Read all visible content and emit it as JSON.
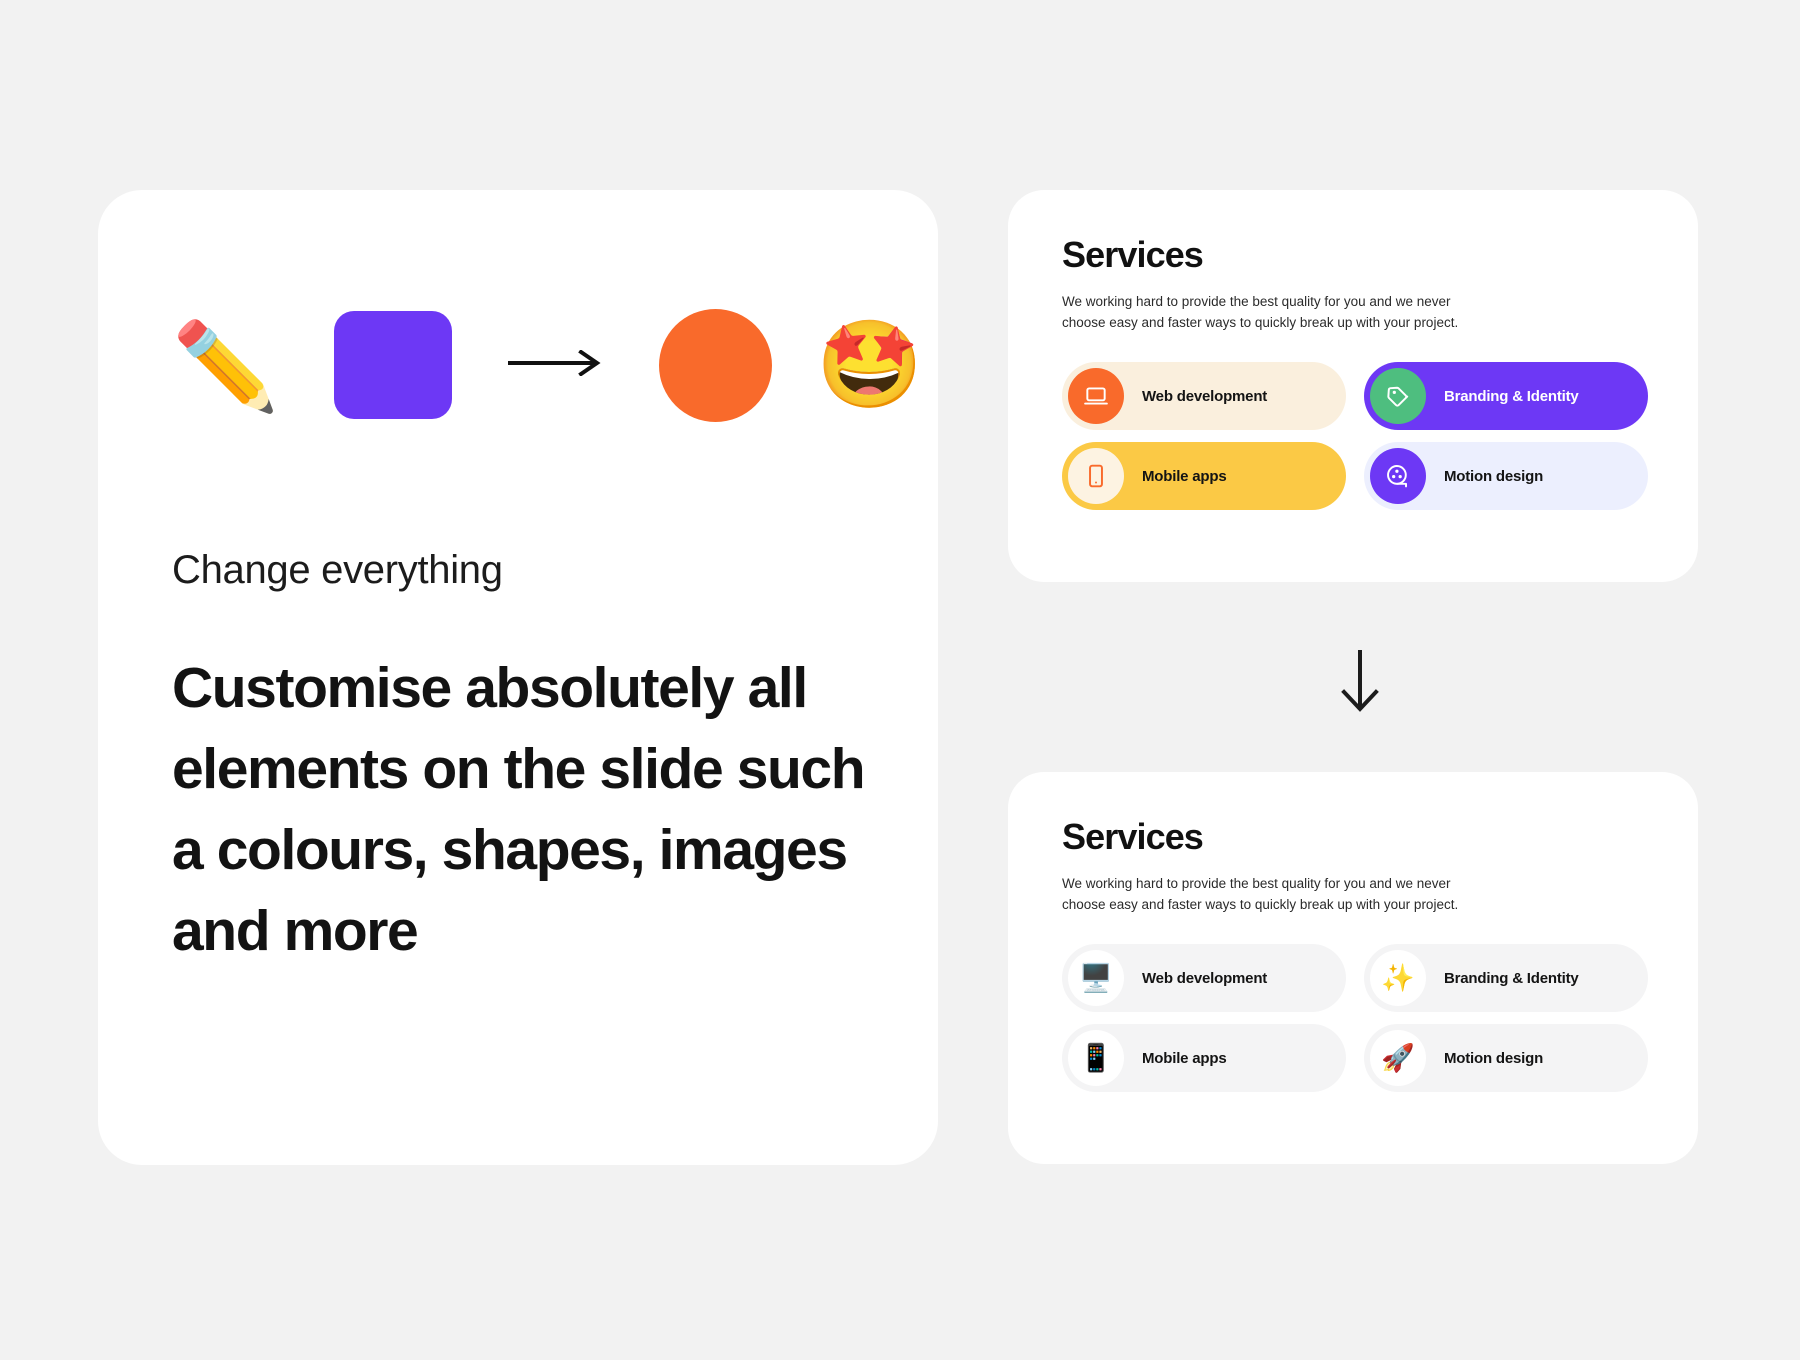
{
  "page": {
    "background_color": "#f2f2f2"
  },
  "left_panel": {
    "shapes": [
      {
        "name": "pencil-emoji",
        "glyph": "✏️"
      },
      {
        "name": "purple-rounded-square",
        "color": "#6d38f5"
      },
      {
        "name": "arrow-right-icon",
        "glyph": "→"
      },
      {
        "name": "orange-circle",
        "color": "#f96a2b"
      },
      {
        "name": "star-struck-emoji",
        "glyph": "🤩"
      }
    ],
    "eyebrow": "Change everything",
    "headline": "Customise absolutely all elements on the slide such a colours, shapes, images and more"
  },
  "divider": {
    "arrow_down_label": "↓"
  },
  "services_top": {
    "title": "Services",
    "description": "We working hard to provide the best quality for you and we never choose easy and faster ways to quickly break up with your project.",
    "items": [
      {
        "label": "Web development",
        "icon": "laptop-icon",
        "pill_color": "#faefdd",
        "icon_bg": "#f96a2b",
        "icon_color": "#ffffff"
      },
      {
        "label": "Branding & Identity",
        "icon": "tag-icon",
        "pill_color": "#6d38f5",
        "icon_bg": "#4ebe7f",
        "icon_color": "#ffffff"
      },
      {
        "label": "Mobile apps",
        "icon": "smartphone-icon",
        "pill_color": "#fbc945",
        "icon_bg": "#fdf3e2",
        "icon_color": "#f96a2b"
      },
      {
        "label": "Motion design",
        "icon": "film-reel-icon",
        "pill_color": "#eceffe",
        "icon_bg": "#6d38f5",
        "icon_color": "#ffffff"
      }
    ]
  },
  "services_bottom": {
    "title": "Services",
    "description": "We working hard to provide the best quality for you and we never choose easy and faster ways to quickly break up with your project.",
    "items": [
      {
        "label": "Web development",
        "icon": "desktop-computer-emoji",
        "glyph": "🖥️",
        "pill_color": "#f4f4f5",
        "icon_bg": "#ffffff"
      },
      {
        "label": "Branding & Identity",
        "icon": "sparkles-emoji",
        "glyph": "✨",
        "pill_color": "#f4f4f5",
        "icon_bg": "#ffffff"
      },
      {
        "label": "Mobile apps",
        "icon": "mobile-phone-emoji",
        "glyph": "📱",
        "pill_color": "#f4f4f5",
        "icon_bg": "#ffffff"
      },
      {
        "label": "Motion design",
        "icon": "rocket-emoji",
        "glyph": "🚀",
        "pill_color": "#f4f4f5",
        "icon_bg": "#ffffff"
      }
    ]
  }
}
